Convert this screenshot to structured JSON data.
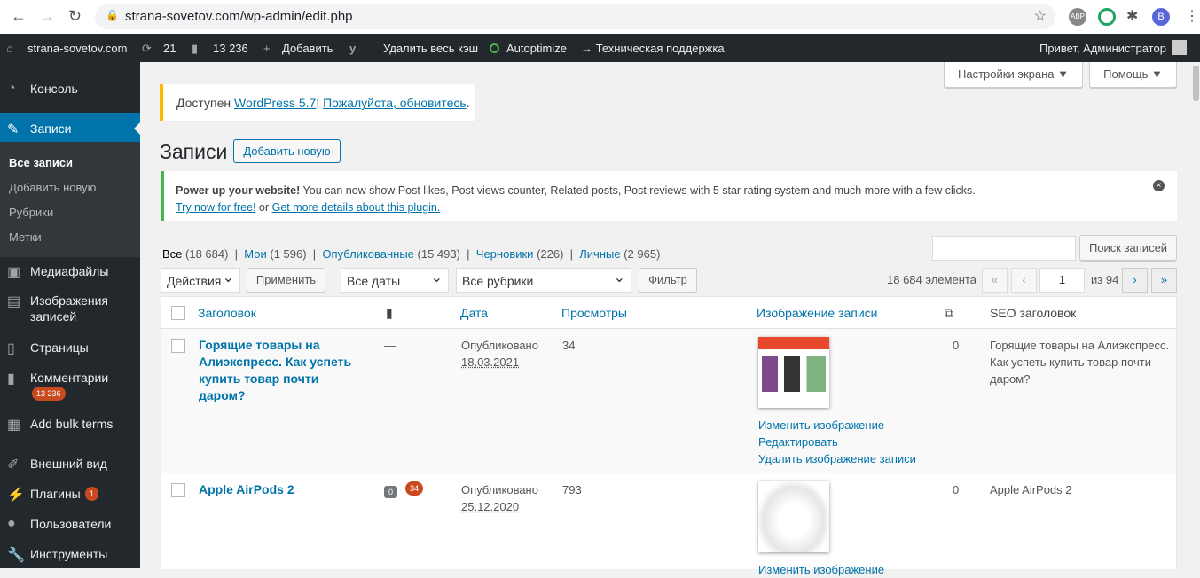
{
  "browser": {
    "url": "strana-sovetov.com/wp-admin/edit.php",
    "profile_initial": "B",
    "abp": "ABP"
  },
  "adminbar": {
    "site": "strana-sovetov.com",
    "updates": "21",
    "comments": "13 236",
    "add": "Добавить",
    "clear_cache": "Удалить весь кэш",
    "autoptimize": "Autoptimize",
    "support": "→ Техническая поддержка",
    "greeting": "Привет, Администратор"
  },
  "sidebar": {
    "items": [
      {
        "label": "Консоль"
      },
      {
        "label": "Записи"
      },
      {
        "label": "Медиафайлы"
      },
      {
        "label": "Изображения записей"
      },
      {
        "label": "Страницы"
      },
      {
        "label": "Комментарии",
        "badge": "13 236"
      },
      {
        "label": "Add bulk terms"
      },
      {
        "label": "Внешний вид"
      },
      {
        "label": "Плагины",
        "badge": "1"
      },
      {
        "label": "Пользователи"
      },
      {
        "label": "Инструменты"
      }
    ],
    "submenu": [
      "Все записи",
      "Добавить новую",
      "Рубрики",
      "Метки"
    ]
  },
  "screen_options": "Настройки экрана ▼",
  "help": "Помощь ▼",
  "update_notice": {
    "prefix": "Доступен ",
    "link1": "WordPress 5.7",
    "sep": "! ",
    "link2": "Пожалуйста, обновитесь",
    "suffix": "."
  },
  "page_title": "Записи",
  "add_new": "Добавить новую",
  "promo": {
    "bold": "Power up your website!",
    "text": " You can now show Post likes, Post views counter, Related posts, Post reviews with 5 star rating system and much more with a few clicks.",
    "link1": "Try now for free!",
    "or": " or ",
    "link2": "Get more details about this plugin."
  },
  "filters": [
    {
      "label": "Все",
      "count": "(18 684)"
    },
    {
      "label": "Мои",
      "count": "(1 596)"
    },
    {
      "label": "Опубликованные",
      "count": "(15 493)"
    },
    {
      "label": "Черновики",
      "count": "(226)"
    },
    {
      "label": "Личные",
      "count": "(2 965)"
    }
  ],
  "search_button": "Поиск записей",
  "bulk_action": "Действия",
  "apply": "Применить",
  "dates": "Все даты",
  "categories": "Все рубрики",
  "filter": "Фильтр",
  "pagination": {
    "total": "18 684 элемента",
    "first": "«",
    "prev": "‹",
    "page": "1",
    "of": "из 94",
    "next": "›",
    "last": "»"
  },
  "columns": {
    "title": "Заголовок",
    "date": "Дата",
    "views": "Просмотры",
    "image": "Изображение записи",
    "seo": "SEO заголовок"
  },
  "rows": [
    {
      "title": "Горящие товары на Алиэкспресс. Как успеть купить товар почти даром?",
      "comments": "—",
      "status": "Опубликовано",
      "date": "18.03.2021",
      "views": "34",
      "count": "0",
      "seo": "Горящие товары на Алиэкспресс. Как успеть купить товар почти даром?",
      "actions": [
        "Изменить изображение",
        "Редактировать",
        "Удалить изображение записи"
      ]
    },
    {
      "title": "Apple AirPods 2",
      "comments_approved": "0",
      "comments_pending": "34",
      "status": "Опубликовано",
      "date": "25.12.2020",
      "views": "793",
      "count": "0",
      "seo": "Apple AirPods 2",
      "actions": [
        "Изменить изображение"
      ]
    }
  ]
}
